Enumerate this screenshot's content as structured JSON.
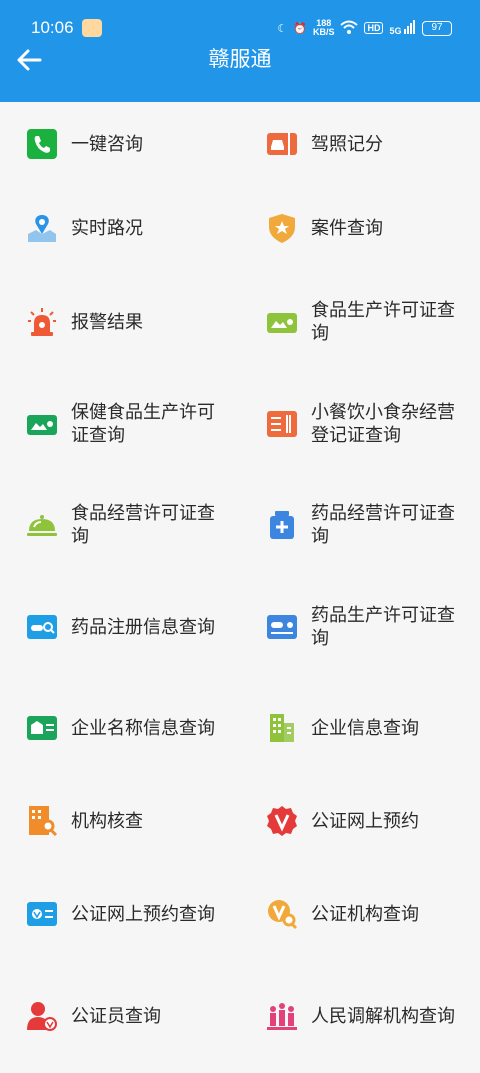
{
  "status": {
    "time": "10:06",
    "speed_top": "188",
    "speed_bottom": "KB/S",
    "hd": "HD",
    "net": "5G",
    "battery": "97"
  },
  "header": {
    "title": "赣服通"
  },
  "items": [
    {
      "label": "一键咨询",
      "color": "#1bb13f",
      "icon": "phone-icon"
    },
    {
      "label": "驾照记分",
      "color": "#ec6a3d",
      "icon": "car-icon"
    },
    {
      "label": "实时路况",
      "color": "#2b94e6",
      "icon": "map-icon"
    },
    {
      "label": "案件查询",
      "color": "#f0a93a",
      "icon": "shield-icon"
    },
    {
      "label": "报警结果",
      "color": "#ef5a36",
      "icon": "alarm-icon"
    },
    {
      "label": "食品生产许可证查询",
      "color": "#8fc33b",
      "icon": "id-card-icon"
    },
    {
      "label": "保健食品生产许可证查询",
      "color": "#1aa55a",
      "icon": "id-card-icon"
    },
    {
      "label": "小餐饮小食杂经营登记证查询",
      "color": "#ef6a3d",
      "icon": "cutlery-icon"
    },
    {
      "label": "食品经营许可证查询",
      "color": "#8fc33b",
      "icon": "dish-cover-icon"
    },
    {
      "label": "药品经营许可证查询",
      "color": "#3d86e0",
      "icon": "medicine-bottle-icon"
    },
    {
      "label": "药品注册信息查询",
      "color": "#1e9fe5",
      "icon": "pill-search-icon"
    },
    {
      "label": "药品生产许可证查询",
      "color": "#3d86e0",
      "icon": "pill-card-icon"
    },
    {
      "label": "企业名称信息查询",
      "color": "#1aa55a",
      "icon": "company-card-icon"
    },
    {
      "label": "企业信息查询",
      "color": "#8fc33b",
      "icon": "building-icon"
    },
    {
      "label": "机构核查",
      "color": "#f08c2a",
      "icon": "building-search-icon"
    },
    {
      "label": "公证网上预约",
      "color": "#e53a3a",
      "icon": "badge-v-icon"
    },
    {
      "label": "公证网上预约查询",
      "color": "#1e9fe5",
      "icon": "card-v-search-icon"
    },
    {
      "label": "公证机构查询",
      "color": "#f0a93a",
      "icon": "v-search-icon"
    },
    {
      "label": "公证员查询",
      "color": "#e53a3a",
      "icon": "person-badge-icon"
    },
    {
      "label": "人民调解机构查询",
      "color": "#e2417a",
      "icon": "people-icon"
    }
  ]
}
